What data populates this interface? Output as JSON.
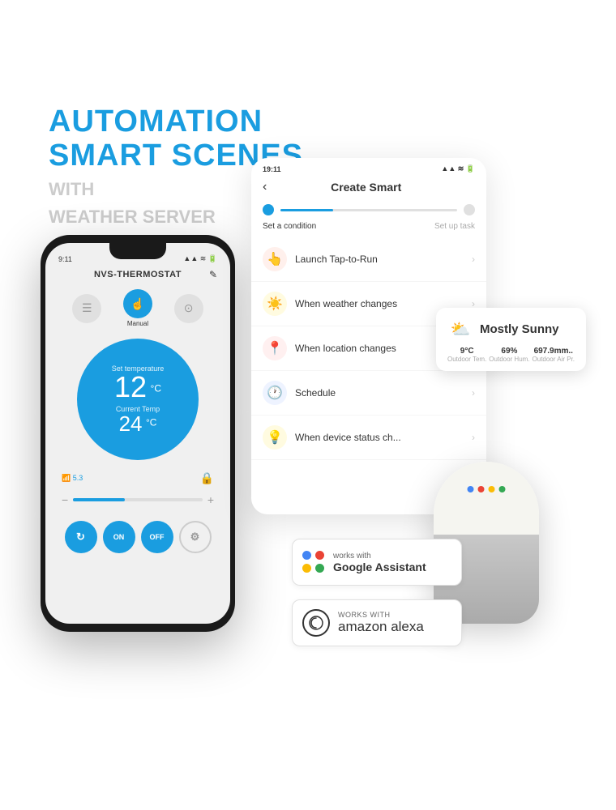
{
  "headline": {
    "line1": "AUTOMATION",
    "line2": "SMART SCENES",
    "sub1": "WITH",
    "sub2": "WEATHER SERVER"
  },
  "phone": {
    "time": "9:11",
    "title": "NVS-THERMOSTAT",
    "mode_label": "Manual",
    "set_temp_label": "Set temperature",
    "set_temp_value": "12",
    "set_temp_unit": "°C",
    "current_temp_label": "Current Temp",
    "current_temp_value": "24",
    "current_temp_unit": "°C",
    "wifi_label": "5.3",
    "on_label": "ON",
    "off_label": "OFF"
  },
  "app_screen": {
    "time": "19:11",
    "title": "Create Smart",
    "step1": "Set a condition",
    "step2": "Set up task",
    "menu_items": [
      {
        "icon": "👆",
        "label": "Launch Tap-to-Run",
        "color": "#ff8c69"
      },
      {
        "icon": "☀️",
        "label": "When weather changes",
        "color": "#ffcc44"
      },
      {
        "icon": "📍",
        "label": "When location changes",
        "color": "#ff6b6b"
      },
      {
        "icon": "🕐",
        "label": "Schedule",
        "color": "#5b8fff"
      },
      {
        "icon": "💡",
        "label": "When device status ch...",
        "color": "#ffcc44"
      }
    ]
  },
  "weather_card": {
    "icon": "⛅",
    "title": "Mostly Sunny",
    "stats": [
      {
        "value": "9°C",
        "label": "Outdoor Tem."
      },
      {
        "value": "69%",
        "label": "Outdoor Hum."
      },
      {
        "value": "697.9mm..",
        "label": "Outdoor Air Pr."
      }
    ]
  },
  "google_badge": {
    "works_with_label": "works with",
    "name": "Google Assistant",
    "dots": [
      "#4285F4",
      "#EA4335",
      "#FBBC05",
      "#34A853"
    ]
  },
  "alexa_badge": {
    "works_with_label": "WORKS WITH",
    "name": "amazon alexa"
  },
  "google_home_dots": [
    "#4285F4",
    "#EA4335",
    "#FBBC05",
    "#34A853"
  ]
}
